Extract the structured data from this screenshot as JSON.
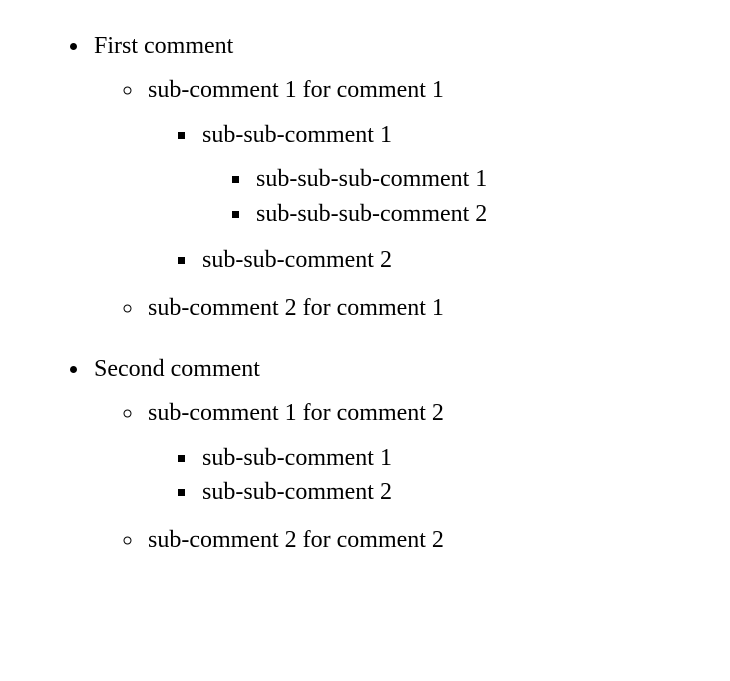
{
  "comments": [
    {
      "text": "First comment",
      "children": [
        {
          "text": "sub-comment 1 for comment 1",
          "children": [
            {
              "text": "sub-sub-comment 1",
              "children": [
                {
                  "text": "sub-sub-sub-comment 1"
                },
                {
                  "text": "sub-sub-sub-comment 2"
                }
              ]
            },
            {
              "text": "sub-sub-comment 2"
            }
          ]
        },
        {
          "text": "sub-comment 2 for comment 1"
        }
      ]
    },
    {
      "text": "Second comment",
      "children": [
        {
          "text": "sub-comment 1 for comment 2",
          "tight": true,
          "children": [
            {
              "text": "sub-sub-comment 1"
            },
            {
              "text": "sub-sub-comment 2"
            }
          ]
        },
        {
          "text": "sub-comment 2 for comment 2"
        }
      ]
    }
  ]
}
